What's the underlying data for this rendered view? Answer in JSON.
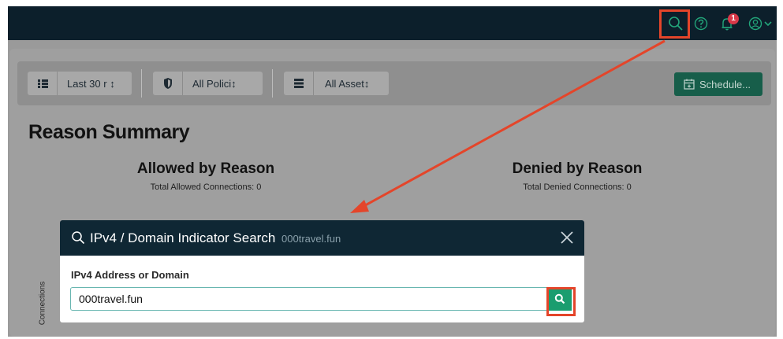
{
  "colors": {
    "topbar": "#0c1f2b",
    "accent_teal": "#1a9d6f",
    "highlight_red": "#e4452a",
    "badge_red": "#d93848"
  },
  "topbar": {
    "icons": [
      "search-icon",
      "help-icon",
      "bell-icon",
      "user-icon",
      "chevron-down-icon"
    ],
    "notification_count": "1"
  },
  "toolbar": {
    "filters": [
      {
        "icon": "list-icon",
        "label": "Last 30 r ↕"
      },
      {
        "icon": "shield-icon",
        "label": "All Polici↕"
      },
      {
        "icon": "server-icon",
        "label": "All Asset↕"
      }
    ],
    "schedule_label": "Schedule..."
  },
  "page": {
    "title": "Reason Summary",
    "allowed": {
      "title": "Allowed by Reason",
      "subtitle": "Total Allowed Connections: 0"
    },
    "denied": {
      "title": "Denied by Reason",
      "subtitle": "Total Denied Connections: 0"
    },
    "chart_axis_label": "Connections"
  },
  "modal": {
    "title": "IPv4 / Domain Indicator Search",
    "query": "000travel.fun",
    "field_label": "IPv4 Address or Domain",
    "input_value": "000travel.fun"
  }
}
